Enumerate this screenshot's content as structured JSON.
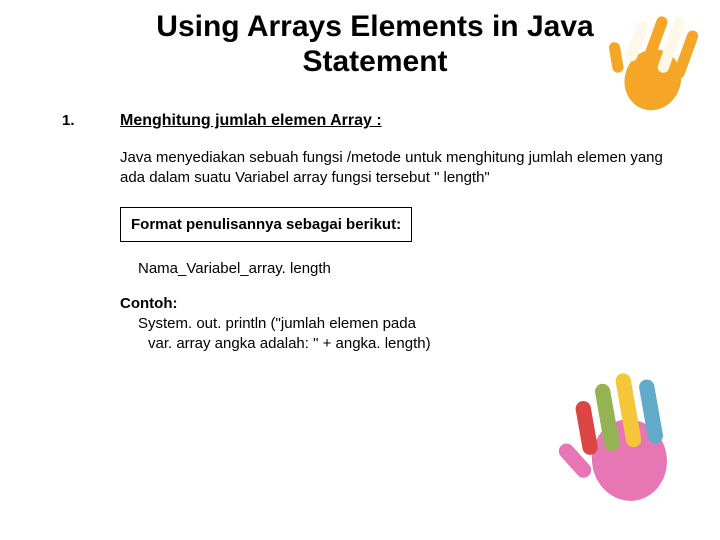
{
  "title": "Using Arrays Elements in Java Statement",
  "list_number": "1.",
  "subtitle": "Menghitung jumlah elemen Array :",
  "body": "Java menyediakan sebuah fungsi /metode untuk menghitung jumlah elemen yang ada dalam suatu Variabel array fungsi tersebut \" length\"",
  "format_box": "Format penulisannya sebagai berikut:",
  "usage": "Nama_Variabel_array. length",
  "example_label": "Contoh:",
  "example_line1": "System. out. println (\"jumlah elemen pada",
  "example_line2": "var. array angka adalah: \" + angka. length)",
  "icons": {
    "hand_top": "handprint-icon",
    "hand_bot": "handprint-icon"
  },
  "colors": {
    "orange": "#f6a21b",
    "milkwhite": "#fff8e8",
    "pink": "#e66fb0",
    "red": "#dc3a3a",
    "green": "#8fb04a",
    "yellow": "#f4c430",
    "blue": "#5aa6c8"
  }
}
